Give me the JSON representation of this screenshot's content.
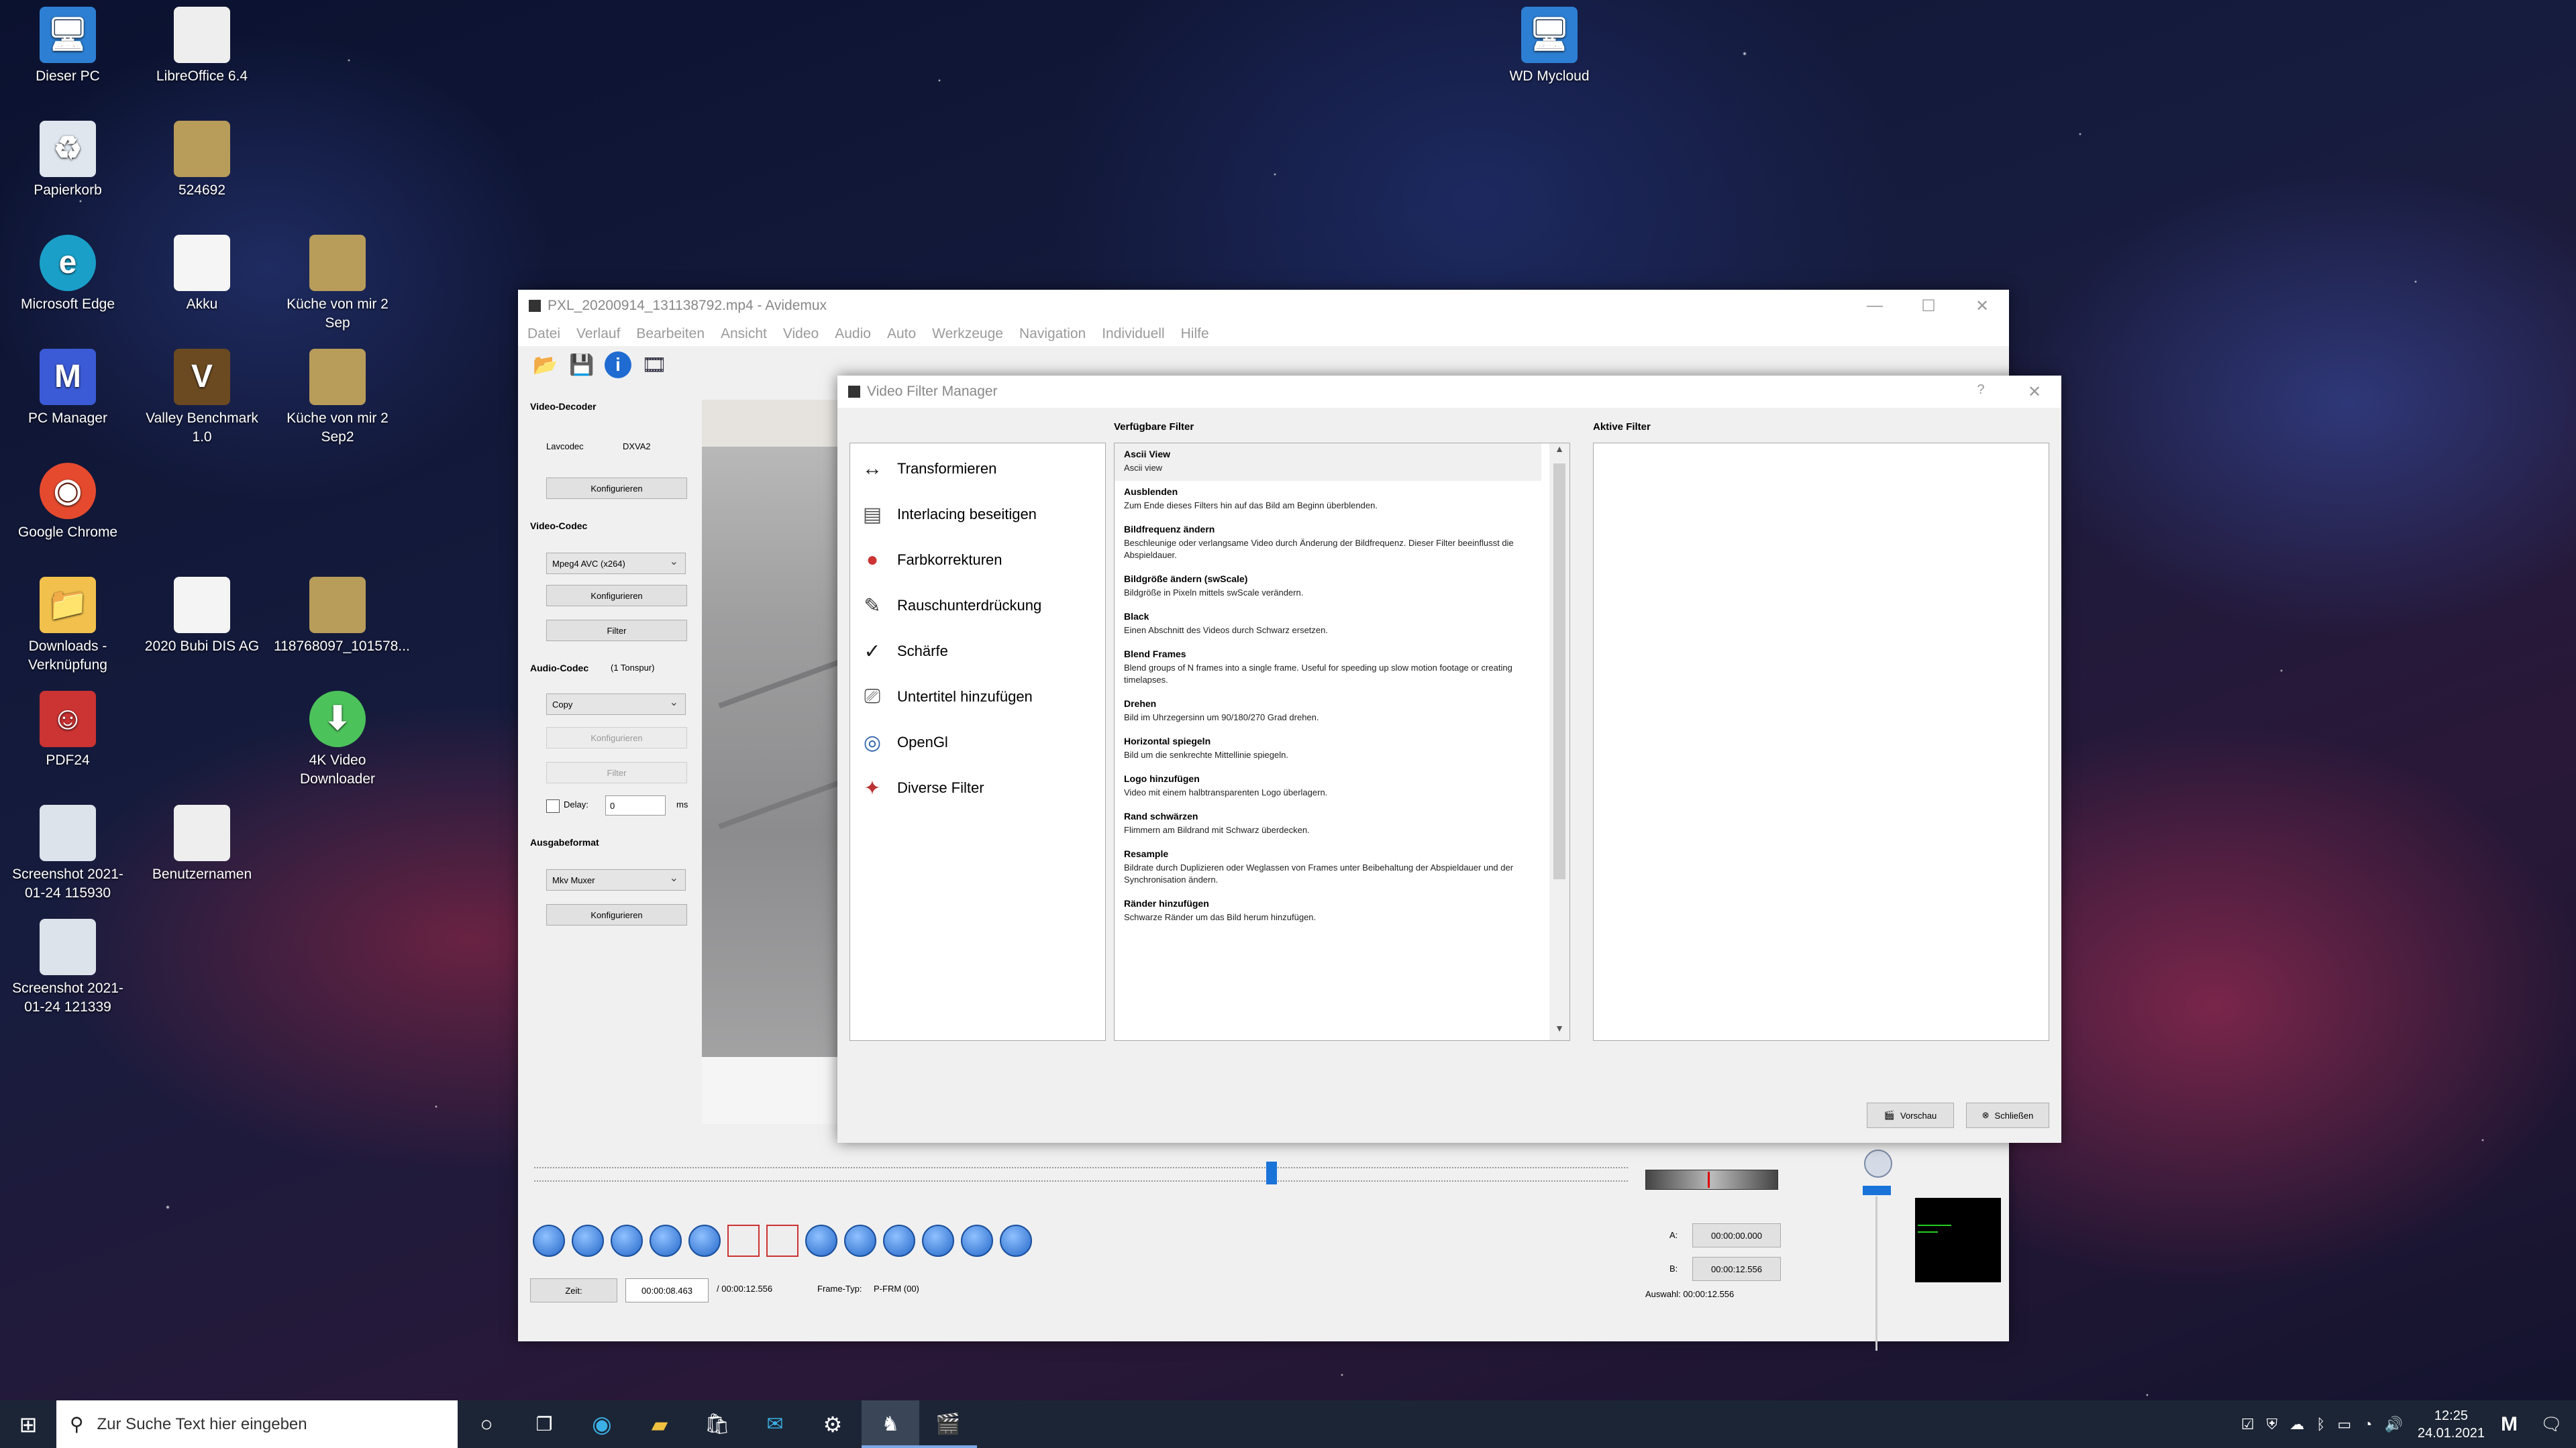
{
  "desktop": {
    "icons": [
      {
        "label": "Dieser PC",
        "icon": "computer-icon"
      },
      {
        "label": "LibreOffice 6.4",
        "icon": "document-icon"
      },
      {
        "label": "WD Mycloud",
        "icon": "network-computer-icon"
      },
      {
        "label": "Papierkorb",
        "icon": "recycle-bin-icon"
      },
      {
        "label": "524692",
        "icon": "image-thumbnail-icon"
      },
      {
        "label": "Microsoft Edge",
        "icon": "edge-icon"
      },
      {
        "label": "Akku",
        "icon": "battery-shortcut-icon"
      },
      {
        "label": "Küche von mir 2 Sep",
        "icon": "image-thumbnail-icon"
      },
      {
        "label": "PC Manager",
        "icon": "pc-manager-icon"
      },
      {
        "label": "Valley Benchmark 1.0",
        "icon": "valley-icon"
      },
      {
        "label": "Küche von mir 2 Sep2",
        "icon": "image-thumbnail-icon"
      },
      {
        "label": "Google Chrome",
        "icon": "chrome-icon"
      },
      {
        "label": "Downloads - Verknüpfung",
        "icon": "folder-shortcut-icon"
      },
      {
        "label": "2020 Bubi DIS AG",
        "icon": "pdf-document-icon"
      },
      {
        "label": "118768097_101578...",
        "icon": "image-thumbnail-icon"
      },
      {
        "label": "PDF24",
        "icon": "pdf24-icon"
      },
      {
        "label": "4K Video Downloader",
        "icon": "4k-downloader-icon"
      },
      {
        "label": "Screenshot 2021-01-24 115930",
        "icon": "screenshot-icon"
      },
      {
        "label": "Benutzernamen",
        "icon": "document-icon"
      },
      {
        "label": "Screenshot 2021-01-24 121339",
        "icon": "screenshot-icon"
      }
    ]
  },
  "avidemux": {
    "title": "PXL_20200914_131138792.mp4 - Avidemux",
    "menu": [
      "Datei",
      "Verlauf",
      "Bearbeiten",
      "Ansicht",
      "Video",
      "Audio",
      "Auto",
      "Werkzeuge",
      "Navigation",
      "Individuell",
      "Hilfe"
    ],
    "video_decoder": {
      "heading": "Video-Decoder",
      "codec": "Lavcodec",
      "hw": "DXVA2",
      "configure": "Konfigurieren"
    },
    "video_codec": {
      "heading": "Video-Codec",
      "value": "Mpeg4 AVC (x264)",
      "configure": "Konfigurieren",
      "filter": "Filter"
    },
    "audio_codec": {
      "heading": "Audio-Codec",
      "tracks": "(1 Tonspur)",
      "value": "Copy",
      "configure": "Konfigurieren",
      "filter": "Filter",
      "delay_label": "Delay:",
      "delay_value": "0",
      "delay_unit": "ms"
    },
    "output_format": {
      "heading": "Ausgabeformat",
      "value": "Mkv Muxer",
      "configure": "Konfigurieren"
    },
    "time": {
      "label": "Zeit:",
      "current": "00:00:08.463",
      "total": "/ 00:00:12.556",
      "frame_type_label": "Frame-Typ:",
      "frame_type": "P-FRM (00)"
    },
    "selection": {
      "a_label": "A:",
      "a_value": "00:00:00.000",
      "b_label": "B:",
      "b_value": "00:00:12.556",
      "summary": "Auswahl: 00:00:12.556"
    },
    "slider_fraction": 0.674
  },
  "filter_manager": {
    "title": "Video Filter Manager",
    "available_heading": "Verfügbare Filter",
    "active_heading": "Aktive Filter",
    "categories": [
      {
        "label": "Transformieren",
        "icon": "transform-icon"
      },
      {
        "label": "Interlacing beseitigen",
        "icon": "interlace-icon"
      },
      {
        "label": "Farbkorrekturen",
        "icon": "color-icon"
      },
      {
        "label": "Rauschunterdrückung",
        "icon": "denoise-icon"
      },
      {
        "label": "Schärfe",
        "icon": "sharpness-icon"
      },
      {
        "label": "Untertitel hinzufügen",
        "icon": "subtitle-icon"
      },
      {
        "label": "OpenGl",
        "icon": "opengl-icon"
      },
      {
        "label": "Diverse Filter",
        "icon": "misc-filter-icon"
      }
    ],
    "filters": [
      {
        "name": "Ascii View",
        "desc": "Ascii view"
      },
      {
        "name": "Ausblenden",
        "desc": "Zum Ende dieses Filters hin auf das Bild am Beginn überblenden."
      },
      {
        "name": "Bildfrequenz ändern",
        "desc": "Beschleunige oder verlangsame Video durch Änderung der Bildfrequenz. Dieser Filter beeinflusst die Abspieldauer."
      },
      {
        "name": "Bildgröße ändern (swScale)",
        "desc": "Bildgröße in Pixeln mittels swScale verändern."
      },
      {
        "name": "Black",
        "desc": "Einen Abschnitt des Videos durch Schwarz ersetzen."
      },
      {
        "name": "Blend Frames",
        "desc": "Blend groups of N frames into a single frame.  Useful for speeding up slow motion footage or creating timelapses."
      },
      {
        "name": "Drehen",
        "desc": "Bild im Uhrzegersinn um 90/180/270 Grad drehen."
      },
      {
        "name": "Horizontal spiegeln",
        "desc": "Bild um die senkrechte Mittellinie spiegeln."
      },
      {
        "name": "Logo hinzufügen",
        "desc": "Video mit einem halbtransparenten Logo überlagern."
      },
      {
        "name": "Rand schwärzen",
        "desc": "Flimmern am Bildrand mit Schwarz überdecken."
      },
      {
        "name": "Resample",
        "desc": "Bildrate durch Duplizieren oder Weglassen von Frames unter Beibehaltung der Abspieldauer und der Synchronisation ändern."
      },
      {
        "name": "Ränder hinzufügen",
        "desc": "Schwarze Ränder um das Bild herum hinzufügen."
      }
    ],
    "preview_button": "Vorschau",
    "close_button": "Schließen",
    "help_glyph": "?"
  },
  "taskbar": {
    "search_placeholder": "Zur Suche Text hier eingeben",
    "time": "12:25",
    "date": "24.01.2021"
  },
  "colors": {
    "accent": "#0078d7",
    "taskbar": "#1c2535"
  }
}
